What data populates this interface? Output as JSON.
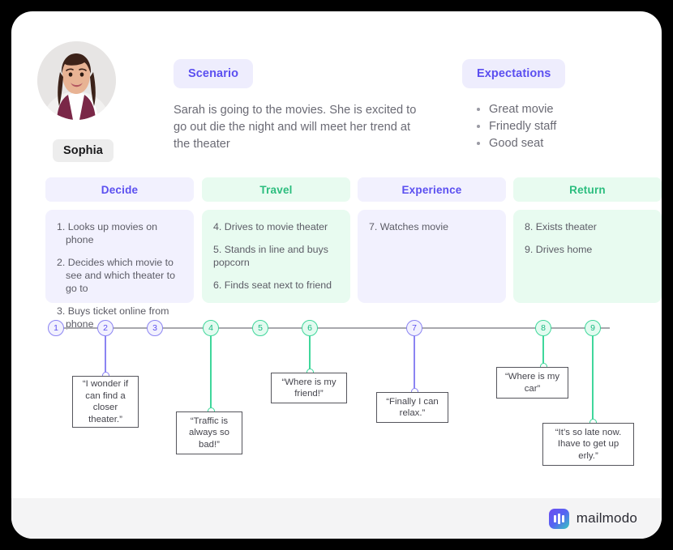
{
  "persona": {
    "avatar_icon": "user-photo-avatar",
    "name": "Sophia"
  },
  "scenario": {
    "label": "Scenario",
    "text": "Sarah is going to the movies. She is excited to go out die the night and will meet her trend at the theater"
  },
  "expectations": {
    "label": "Expectations",
    "items": [
      "Great movie",
      "Frinedly staff",
      "Good seat"
    ]
  },
  "stages": [
    {
      "label": "Decide",
      "accent": "#5b4ff0",
      "head_bg": "#f2f1fe",
      "body_bg": "#f2f1fe",
      "items": [
        "1. Looks up movies on phone",
        "2. Decides which movie to see and which theater to go to",
        "3. Buys ticket online from phone"
      ]
    },
    {
      "label": "Travel",
      "accent": "#2bbd7e",
      "head_bg": "#e8fbf0",
      "body_bg": "#e8fbf0",
      "items": [
        "4. Drives to movie theater",
        "5. Stands in line and buys popcorn",
        "6. Finds seat next to friend"
      ]
    },
    {
      "label": "Experience",
      "accent": "#5b4ff0",
      "head_bg": "#f2f1fe",
      "body_bg": "#f2f1fe",
      "items": [
        "7. Watches movie"
      ]
    },
    {
      "label": "Return",
      "accent": "#2bbd7e",
      "head_bg": "#e8fbf0",
      "body_bg": "#e8fbf0",
      "items": [
        "8. Exists theater",
        "9. Drives home"
      ]
    }
  ],
  "timeline": {
    "line_color": "#a8a8ad",
    "purple": "#8b84f2",
    "green": "#3fd79b",
    "nodes": [
      {
        "number": "1",
        "color": "purple"
      },
      {
        "number": "2",
        "color": "purple"
      },
      {
        "number": "3",
        "color": "purple"
      },
      {
        "number": "4",
        "color": "green"
      },
      {
        "number": "5",
        "color": "green"
      },
      {
        "number": "6",
        "color": "green"
      },
      {
        "number": "7",
        "color": "purple"
      },
      {
        "number": "8",
        "color": "green"
      },
      {
        "number": "9",
        "color": "green"
      }
    ],
    "quotes": [
      {
        "node": "2",
        "color": "purple",
        "text": "“I wonder if can find a closer theater.”"
      },
      {
        "node": "4",
        "color": "green",
        "text": "“Traffic is always so bad!”"
      },
      {
        "node": "6",
        "color": "green",
        "text": "“Where is my friend!”"
      },
      {
        "node": "7",
        "color": "purple",
        "text": "“Finally I can relax.”"
      },
      {
        "node": "8",
        "color": "green",
        "text": "“Where is my car”"
      },
      {
        "node": "9",
        "color": "green",
        "text": "“It’s so late now. Ihave to get up erly.”"
      }
    ]
  },
  "footer": {
    "brand_name": "mailmodo",
    "brand_icon": "mailmodo-logo-icon"
  }
}
